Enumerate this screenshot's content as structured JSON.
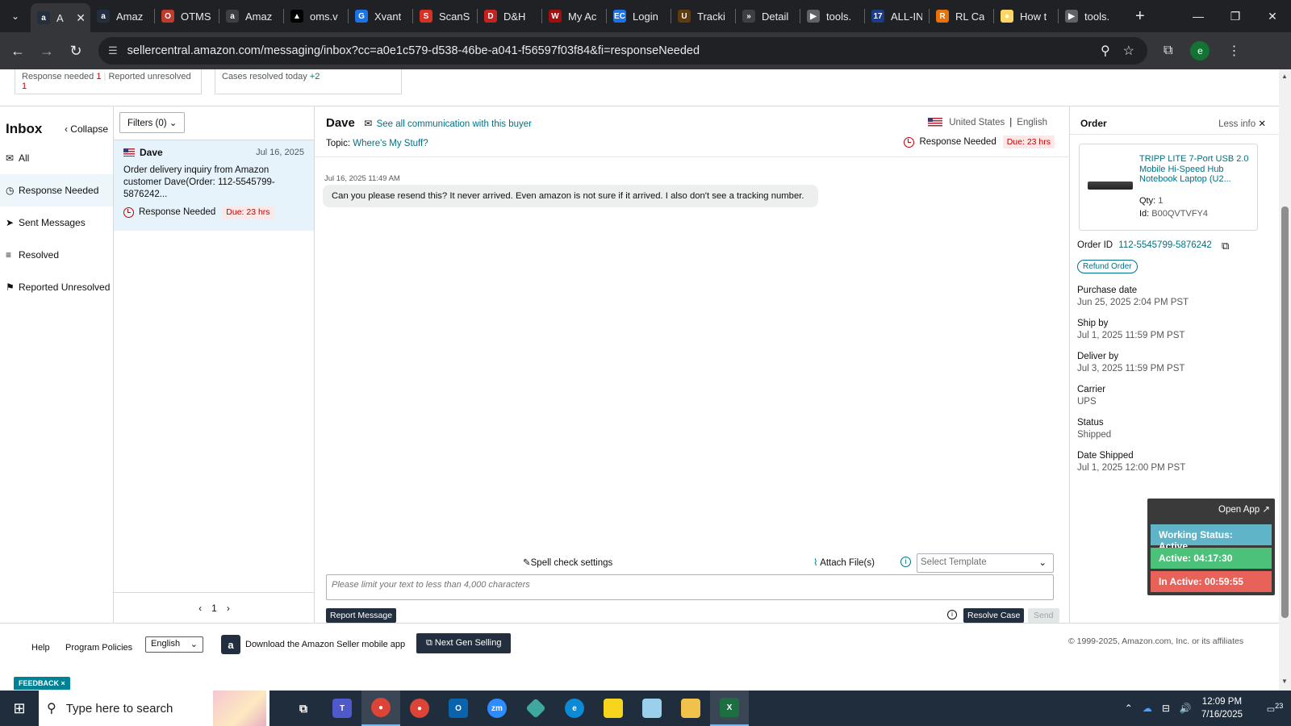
{
  "browser": {
    "tabs": [
      {
        "title": "A",
        "icon": "amazon-icon",
        "color": "#232f3e",
        "glyph": "a",
        "active": true
      },
      {
        "title": "Amaz",
        "icon": "amazon-icon",
        "color": "#232f3e",
        "glyph": "a"
      },
      {
        "title": "OTMS",
        "icon": "otms-icon",
        "color": "#c13b2c",
        "glyph": "O"
      },
      {
        "title": "Amaz",
        "icon": "amazon-icon",
        "color": "#3c4043",
        "glyph": "a"
      },
      {
        "title": "oms.v",
        "icon": "oms-icon",
        "color": "#000000",
        "glyph": "▲"
      },
      {
        "title": "Xvant",
        "icon": "xvant-icon",
        "color": "#1a73e8",
        "glyph": "G"
      },
      {
        "title": "ScanS",
        "icon": "scans-icon",
        "color": "#d93025",
        "glyph": "S"
      },
      {
        "title": "D&H",
        "icon": "dh-icon",
        "color": "#c5221f",
        "glyph": "D"
      },
      {
        "title": "My Ac",
        "icon": "myac-icon",
        "color": "#a50e0e",
        "glyph": "W"
      },
      {
        "title": "Login",
        "icon": "ec-icon",
        "color": "#1a73e8",
        "glyph": "EC"
      },
      {
        "title": "Tracki",
        "icon": "ups-icon",
        "color": "#5f3b0f",
        "glyph": "U"
      },
      {
        "title": "Detail",
        "icon": "detail-icon",
        "color": "#3c4043",
        "glyph": "»"
      },
      {
        "title": "tools.",
        "icon": "tools-icon",
        "color": "#5f6368",
        "glyph": "▶"
      },
      {
        "title": "ALL-IN",
        "icon": "allin-icon",
        "color": "#1a3a8a",
        "glyph": "17"
      },
      {
        "title": "RL Ca",
        "icon": "rl-icon",
        "color": "#e8710a",
        "glyph": "R"
      },
      {
        "title": "How t",
        "icon": "howto-icon",
        "color": "#fdd663",
        "glyph": "●"
      },
      {
        "title": "tools.",
        "icon": "tools-icon",
        "color": "#5f6368",
        "glyph": "▶"
      }
    ],
    "url": "sellercentral.amazon.com/messaging/inbox?cc=a0e1c579-d538-46be-a041-f56597f03f84&fi=responseNeeded",
    "profile_initial": "e"
  },
  "stats": {
    "response_needed_label": "Response needed",
    "response_needed_count": "1",
    "reported_unresolved_label": "Reported unresolved",
    "reported_unresolved_count": "1",
    "cases_resolved_label": "Cases resolved today",
    "cases_resolved_count": "+2"
  },
  "sidebar": {
    "title": "Inbox",
    "collapse_label": "Collapse",
    "items": [
      {
        "label": "All",
        "icon": "mail-icon"
      },
      {
        "label": "Response Needed",
        "icon": "clock-icon"
      },
      {
        "label": "Sent Messages",
        "icon": "send-icon"
      },
      {
        "label": "Resolved",
        "icon": "resolved-icon"
      },
      {
        "label": "Reported Unresolved",
        "icon": "reported-icon"
      }
    ]
  },
  "threads": {
    "filters_label": "Filters (0)",
    "items": [
      {
        "name": "Dave",
        "date": "Jul 16, 2025",
        "subject": "Order delivery inquiry from Amazon customer Dave(Order: 112-5545799-5876242...",
        "status": "Response Needed",
        "due": "Due: 23 hrs"
      }
    ],
    "page": "1"
  },
  "conversation": {
    "buyer": "Dave",
    "see_all": "See all communication with this buyer",
    "country": "United States",
    "language": "English",
    "topic_label": "Topic:",
    "topic": "Where's My Stuff?",
    "status": "Response Needed",
    "due": "Due: 23 hrs",
    "message_time": "Jul 16, 2025 11:49 AM",
    "message_text": "Can you please resend this?  It never arrived.  Even amazon is not sure if it arrived.  I also don't see a tracking number.",
    "spell_check": "Spell check settings",
    "attach": "Attach File(s)",
    "template_placeholder": "Select Template",
    "input_placeholder": "Please limit your text to less than 4,000 characters",
    "report_btn": "Report Message",
    "resolve_btn": "Resolve Case",
    "send_btn": "Send"
  },
  "order": {
    "title": "Order",
    "less_info": "Less info",
    "product_title": "TRIPP LITE 7-Port USB 2.0 Mobile Hi-Speed Hub Notebook Laptop (U2...",
    "qty_label": "Qty:",
    "qty": "1",
    "id_label": "Id:",
    "id": "B00QVTVFY4",
    "order_id_label": "Order ID",
    "order_id": "112-5545799-5876242",
    "refund_btn": "Refund Order",
    "fields": [
      {
        "label": "Purchase date",
        "value": "Jun 25, 2025 2:04 PM PST"
      },
      {
        "label": "Ship by",
        "value": "Jul 1, 2025 11:59 PM PST"
      },
      {
        "label": "Deliver by",
        "value": "Jul 3, 2025 11:59 PM PST"
      },
      {
        "label": "Carrier",
        "value": "UPS"
      },
      {
        "label": "Status",
        "value": "Shipped"
      },
      {
        "label": "Date Shipped",
        "value": "Jul 1, 2025 12:00 PM PST"
      }
    ]
  },
  "widget": {
    "open_app": "Open App ↗",
    "working_status": "Working Status: Active",
    "active": "Active: 04:17:30",
    "inactive": "In Active: 00:59:55"
  },
  "footer": {
    "help": "Help",
    "policies": "Program Policies",
    "language": "English",
    "app_text": "Download the Amazon Seller mobile app",
    "ngs": "Next Gen Selling",
    "copyright": "© 1999-2025, Amazon.com, Inc. or its affiliates",
    "feedback": "FEEDBACK ×"
  },
  "taskbar": {
    "search_placeholder": "Type here to search",
    "time": "12:09 PM",
    "date": "7/16/2025",
    "notifications": "23"
  }
}
